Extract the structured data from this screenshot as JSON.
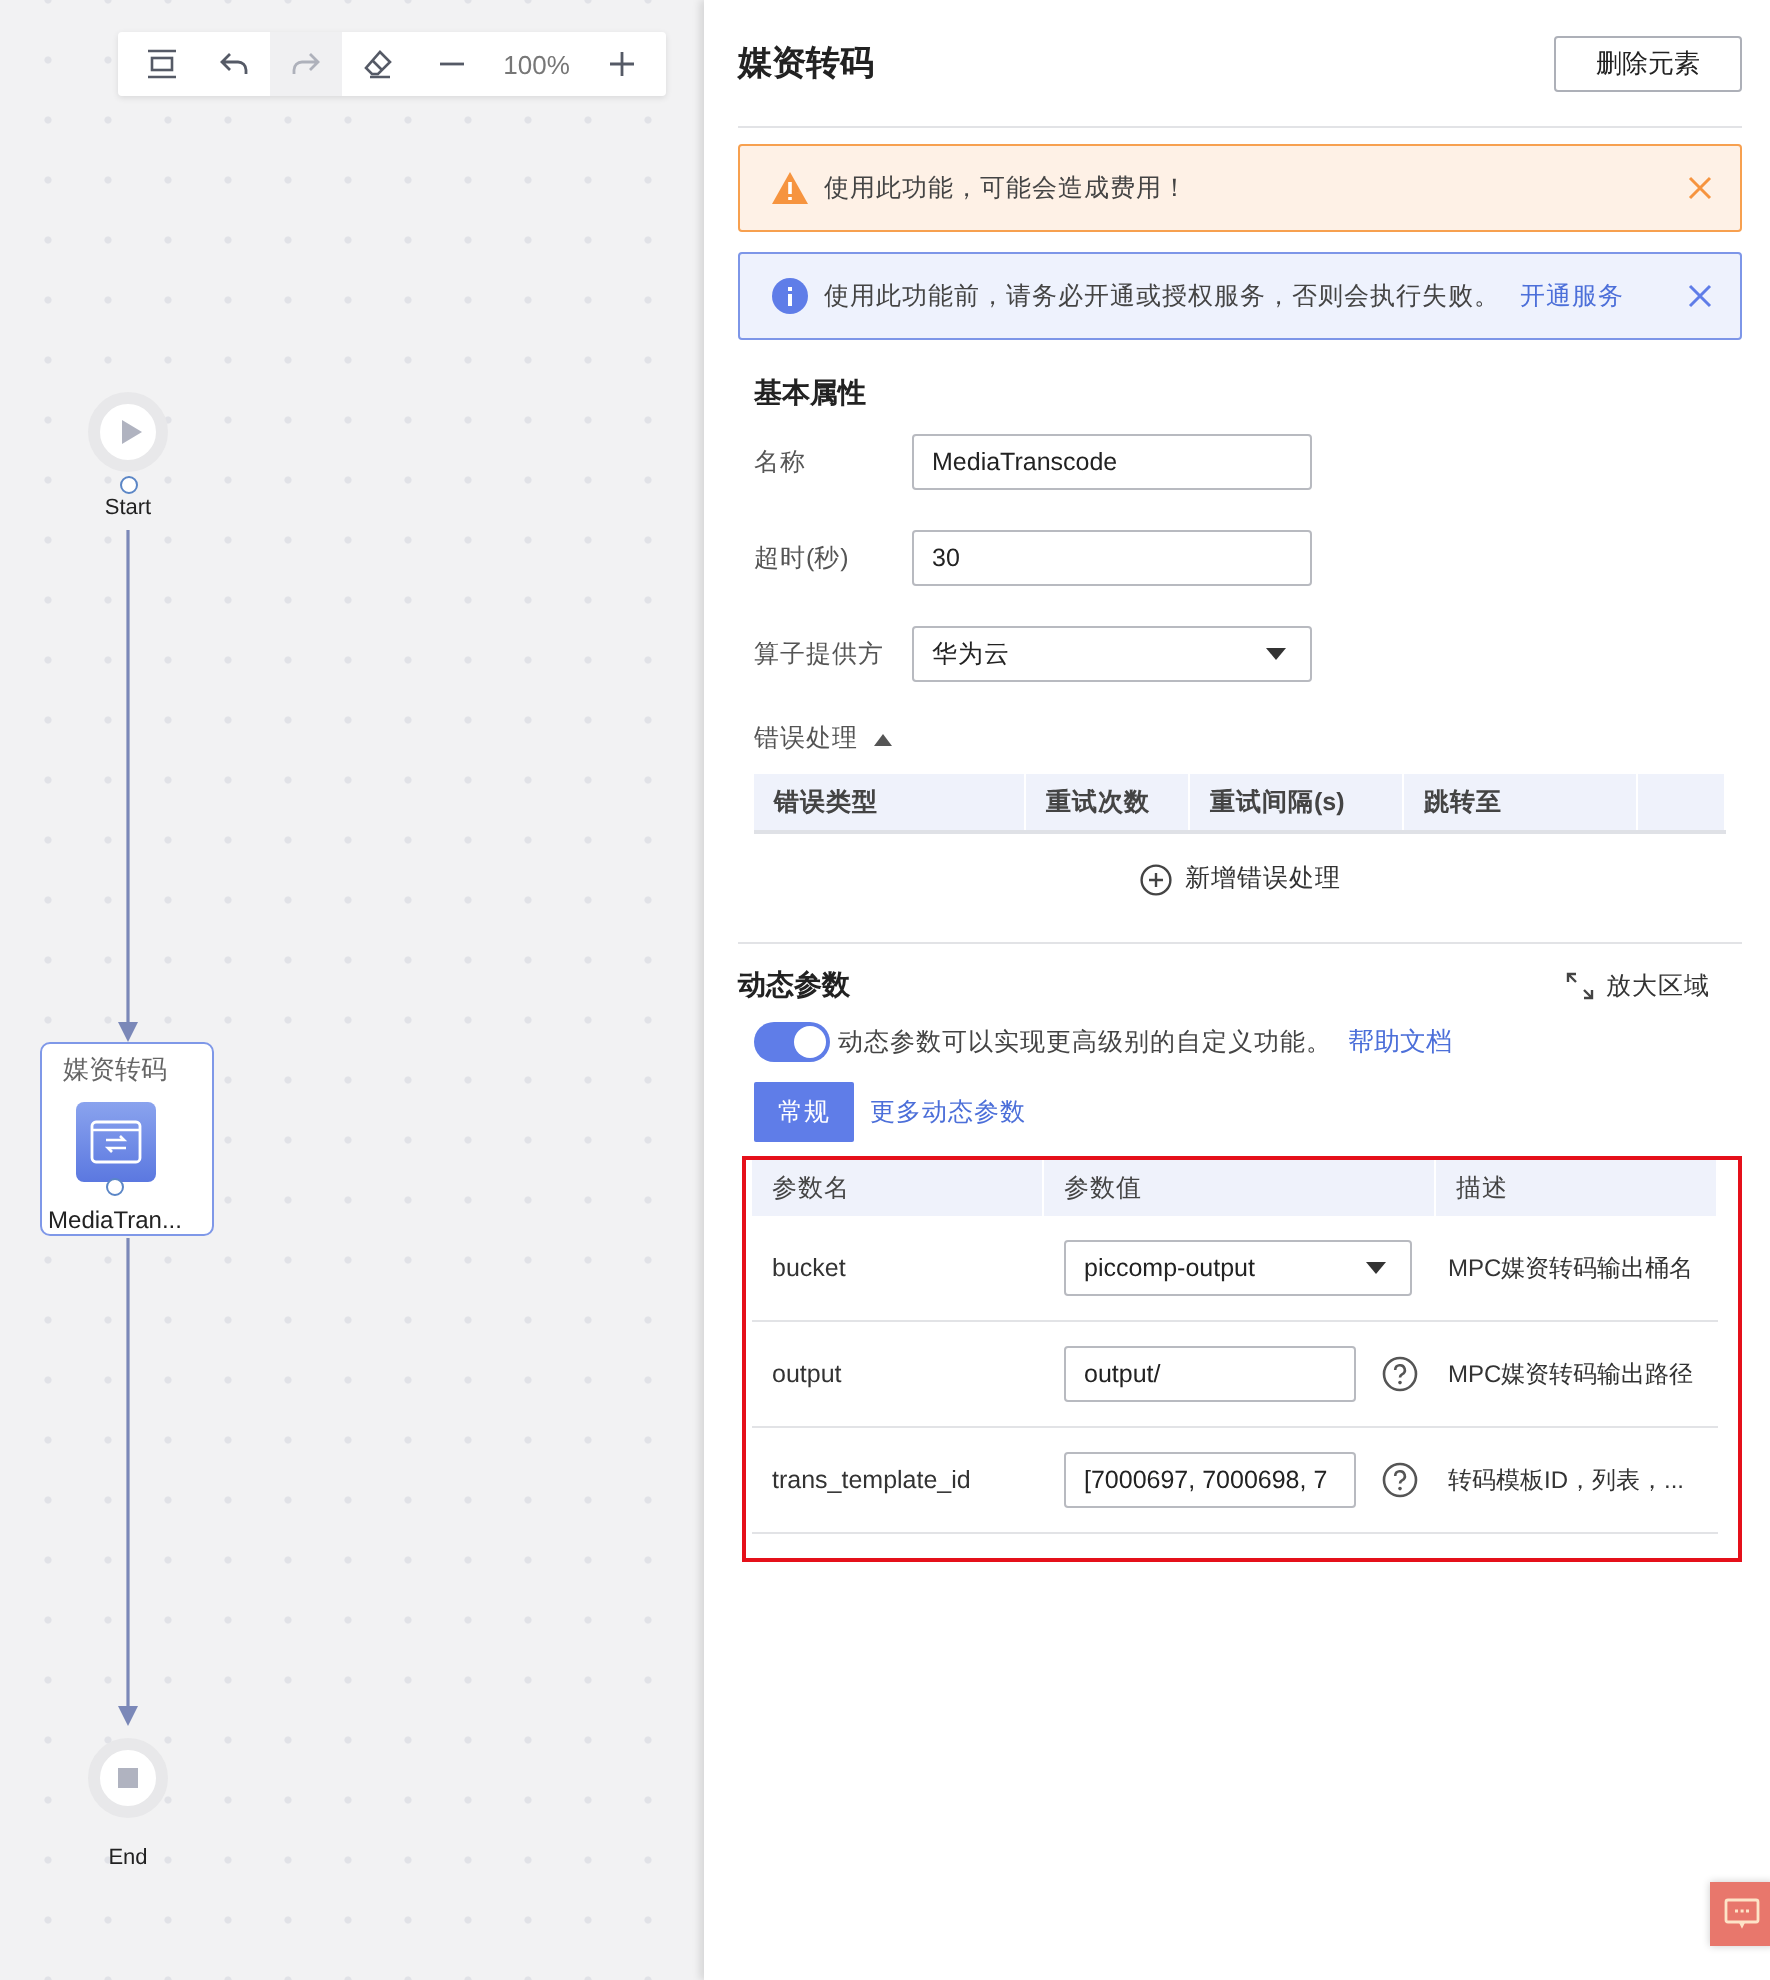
{
  "toolbar": {
    "items": [
      {
        "kind": "fit",
        "disabled": false
      },
      {
        "kind": "undo",
        "disabled": false
      },
      {
        "kind": "redo",
        "disabled": true
      },
      {
        "kind": "eraser",
        "disabled": false
      },
      {
        "kind": "zoom-out",
        "disabled": false
      },
      {
        "kind": "zoom-level",
        "text": "100%"
      },
      {
        "kind": "zoom-in",
        "disabled": false
      }
    ]
  },
  "flow": {
    "nodes": [
      {
        "kind": "start",
        "label": "Start"
      },
      {
        "kind": "task",
        "title": "媒资转码",
        "label": "MediaTran...",
        "selected": true
      },
      {
        "kind": "end",
        "label": "End"
      }
    ]
  },
  "panel": {
    "title": "媒资转码",
    "delete_button": "删除元素",
    "alerts": [
      {
        "kind": "warning",
        "text": "使用此功能，可能会造成费用！"
      },
      {
        "kind": "info",
        "text": "使用此功能前，请务必开通或授权服务，否则会执行失败。",
        "link": "开通服务"
      }
    ],
    "basic": {
      "heading": "基本属性",
      "fields": [
        {
          "label": "名称",
          "kind": "text",
          "value": "MediaTranscode"
        },
        {
          "label": "超时(秒)",
          "kind": "text",
          "value": "30"
        },
        {
          "label": "算子提供方",
          "kind": "select",
          "value": "华为云"
        }
      ]
    },
    "error_handling": {
      "label": "错误处理",
      "expanded": true,
      "columns": [
        "错误类型",
        "重试次数",
        "重试间隔(s)",
        "跳转至"
      ],
      "add_label": "新增错误处理"
    },
    "dynamic": {
      "heading": "动态参数",
      "expand_label": "放大区域",
      "toggle": {
        "on": true,
        "text": "动态参数可以实现更高级别的自定义功能。",
        "link": "帮助文档"
      },
      "tabs": [
        {
          "label": "常规",
          "selected": true
        },
        {
          "label": "更多动态参数",
          "selected": false
        }
      ],
      "columns": [
        "参数名",
        "参数值",
        "描述"
      ],
      "rows": [
        {
          "name": "bucket",
          "kind": "select",
          "value": "piccomp-output",
          "description": "MPC媒资转码输出桶名"
        },
        {
          "name": "output",
          "kind": "text",
          "value": "output/",
          "description": "MPC媒资转码输出路径"
        },
        {
          "name": "trans_template_id",
          "kind": "text",
          "value": "[7000697, 7000698, 7",
          "description": "转码模板ID，列表，..."
        }
      ]
    }
  }
}
